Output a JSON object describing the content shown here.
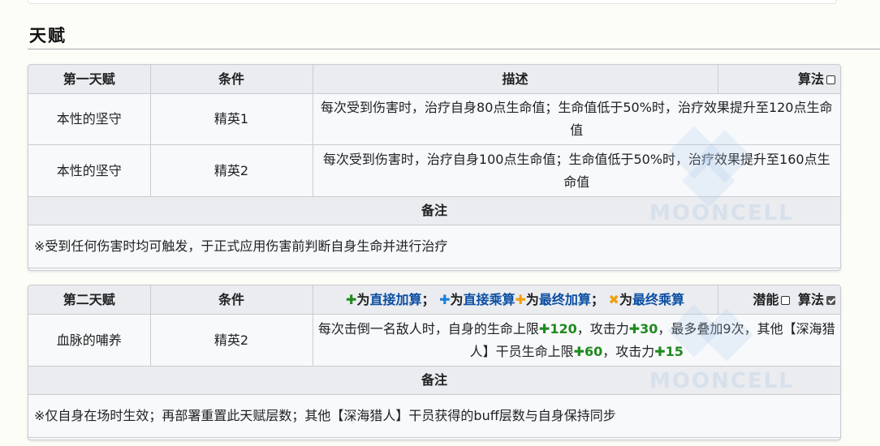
{
  "section_title": "天赋",
  "talent1": {
    "headers": {
      "name": "第一天赋",
      "condition": "条件",
      "description": "描述",
      "formula": "算法"
    },
    "formula_checked": false,
    "rows": [
      {
        "name": "本性的坚守",
        "condition": "精英1",
        "description": "每次受到伤害时，治疗自身80点生命值；生命值低于50%时，治疗效果提升至120点生命值"
      },
      {
        "name": "本性的坚守",
        "condition": "精英2",
        "description": "每次受到伤害时，治疗自身100点生命值；生命值低于50%时，治疗效果提升至160点生命值"
      }
    ],
    "note_header": "备注",
    "note": "※受到任何伤害时均可触发，于正式应用伤害前判断自身生命并进行治疗"
  },
  "talent2": {
    "headers": {
      "name": "第二天赋",
      "condition": "条件",
      "legend": {
        "p1_sym": "✚",
        "p1_text": "为",
        "p1_link": "直接加算",
        "sep1": "；",
        "p2_sym": "✚",
        "p2_text": "为",
        "p2_link": "直接乘算",
        "p3_sym": "✚",
        "p3_text": "为",
        "p3_link": "最终加算",
        "sep2": "；",
        "p4_sym": "✖",
        "p4_text": "为",
        "p4_link": "最终乘算"
      },
      "potential": "潜能",
      "formula": "算法"
    },
    "potential_checked": false,
    "formula_checked": true,
    "row": {
      "name": "血脉的哺养",
      "condition": "精英2",
      "desc_a": "每次击倒一名敌人时，自身的生命上限",
      "val_hp": "✚120",
      "desc_b": "，攻击力",
      "val_atk": "✚30",
      "desc_c": "，最多叠加9次，其他【深海猎人】干员生命上限",
      "val_hp2": "✚60",
      "desc_d": "，攻击力",
      "val_atk2": "✚15"
    },
    "note_header": "备注",
    "note": "※仅自身在场时生效；再部署重置此天赋层数；其他【深海猎人】干员获得的buff层数与自身保持同步"
  },
  "watermark": "MOONCELL",
  "colors": {
    "green": "#1f8a1f",
    "blue": "#1a7fd4",
    "orange": "#f0a010",
    "link": "#0b4ea2"
  }
}
